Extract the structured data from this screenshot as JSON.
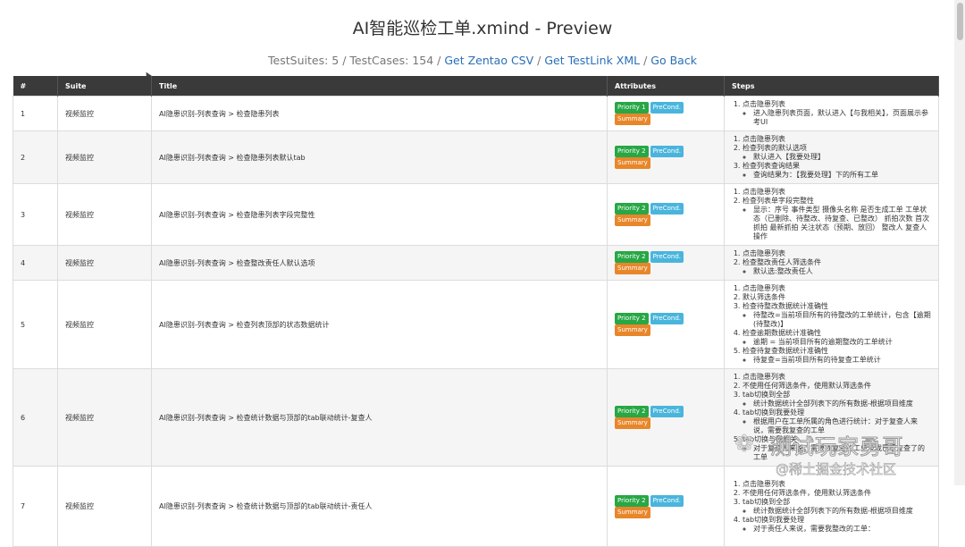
{
  "title": "AI智能巡检工单.xmind - Preview",
  "summary": {
    "testsuites": "TestSuites: 5",
    "sep1": " / ",
    "testcases": "TestCases: 154",
    "sep2": " / ",
    "zentao": "Get Zentao CSV",
    "sep3": " / ",
    "testlink": "Get TestLink XML",
    "sep4": " / ",
    "back": "Go Back"
  },
  "table": {
    "headers": [
      "#",
      "Suite",
      "Title",
      "Attributes",
      "Steps"
    ],
    "badges": {
      "precond": "PreCond.",
      "summary": "Summary"
    },
    "rows": [
      {
        "num": "1",
        "suite": "视频监控",
        "title": "AI隐患识别-列表查询 > 检查隐患列表",
        "priority": "Priority 1",
        "steps": [
          {
            "text": "点击隐患列表",
            "subs": [
              "进入隐患列表页面，默认进入【与我相关】，页面展示参考UI"
            ]
          }
        ]
      },
      {
        "num": "2",
        "suite": "视频监控",
        "title": "AI隐患识别-列表查询 > 检查隐患列表默认tab",
        "priority": "Priority 2",
        "steps": [
          {
            "text": "点击隐患列表",
            "subs": []
          },
          {
            "text": "检查列表的默认选项",
            "subs": [
              "默认进入【我要处理】"
            ]
          },
          {
            "text": "检查列表查询结果",
            "subs": [
              "查询结果为：【我要处理】下的所有工单"
            ]
          }
        ]
      },
      {
        "num": "3",
        "suite": "视频监控",
        "title": "AI隐患识别-列表查询 > 检查隐患列表字段完整性",
        "priority": "Priority 2",
        "steps": [
          {
            "text": "点击隐患列表",
            "subs": []
          },
          {
            "text": "检查列表单字段完整性",
            "subs": [
              "显示：序号 事件类型 摄像头名称 是否生成工单 工单状态（已删除、待整改、待复查、已整改） 抓拍次数 首次抓拍 最新抓拍 关注状态（预期、放回） 整改人 复查人 操作"
            ]
          }
        ]
      },
      {
        "num": "4",
        "suite": "视频监控",
        "title": "AI隐患识别-列表查询 > 检查整改责任人默认选项",
        "priority": "Priority 2",
        "steps": [
          {
            "text": "点击隐患列表",
            "subs": []
          },
          {
            "text": "检查整改责任人筛选条件",
            "subs": [
              "默认选:整改责任人"
            ]
          }
        ]
      },
      {
        "num": "5",
        "suite": "视频监控",
        "title": "AI隐患识别-列表查询 > 检查列表顶部的状态数据统计",
        "priority": "Priority 2",
        "steps": [
          {
            "text": "点击隐患列表",
            "subs": []
          },
          {
            "text": "默认筛选条件",
            "subs": []
          },
          {
            "text": "检查待整改数据统计准确性",
            "subs": [
              "待整改=当前项目所有的待整改的工单统计，包含【逾期(待整改)】"
            ]
          },
          {
            "text": "检查逾期数据统计准确性",
            "subs": [
              "逾期 = 当前项目所有的逾期整改的工单统计"
            ]
          },
          {
            "text": "检查待复查数据统计准确性",
            "subs": [
              "待复查=当前项目所有的待复查工单统计"
            ]
          }
        ]
      },
      {
        "num": "6",
        "suite": "视频监控",
        "title": "AI隐患识别-列表查询 > 检查统计数据与顶部的tab联动统计-复查人",
        "priority": "Priority 2",
        "steps": [
          {
            "text": "点击隐患列表",
            "subs": []
          },
          {
            "text": "不使用任何筛选条件，使用默认筛选条件",
            "subs": []
          },
          {
            "text": "tab切换到全部",
            "subs": [
              "统计数据统计全部列表下的所有数据-根据项目维度"
            ]
          },
          {
            "text": "tab切换到我要处理",
            "subs": [
              "根据用户在工单所属的角色进行统计：对于复查人来说，需要我复查的工单"
            ]
          },
          {
            "text": "tab切换与我相关",
            "subs": [
              "对于复查人来说，需要我复查的工单及我已经复查了的工单"
            ]
          }
        ]
      },
      {
        "num": "7",
        "suite": "视频监控",
        "title": "AI隐患识别-列表查询 > 检查统计数据与顶部的tab联动统计-责任人",
        "priority": "Priority 2",
        "steps": [
          {
            "text": "点击隐患列表",
            "subs": []
          },
          {
            "text": "不使用任何筛选条件，使用默认筛选条件",
            "subs": []
          },
          {
            "text": "tab切换到全部",
            "subs": [
              "统计数据统计全部列表下的所有数据-根据项目维度"
            ]
          },
          {
            "text": "tab切换到我要处理",
            "subs": [
              "对于责任人来说，需要我整改的工单："
            ]
          }
        ]
      }
    ]
  },
  "watermark": {
    "line1": "测试玩家勇哥",
    "line2": "@稀土掘金技术社区"
  }
}
